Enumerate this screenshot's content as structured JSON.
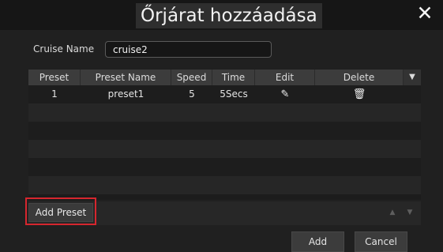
{
  "dialog": {
    "title": "Őrjárat hozzáadása",
    "close_icon": "close-icon"
  },
  "form": {
    "cruise_name_label": "Cruise Name",
    "cruise_name_value": "cruise2"
  },
  "table": {
    "columns": [
      "Preset",
      "Preset Name",
      "Speed",
      "Time",
      "Edit",
      "Delete"
    ],
    "dropdown_icon": "chevron-down-icon",
    "rows": [
      {
        "preset": "1",
        "preset_name": "preset1",
        "speed": "5",
        "time": "5Secs",
        "edit_icon": "pencil-icon",
        "delete_icon": "trash-icon"
      }
    ]
  },
  "actions": {
    "add_preset_label": "Add Preset",
    "move_up_icon": "arrow-up-icon",
    "move_down_icon": "arrow-down-icon",
    "add_label": "Add",
    "cancel_label": "Cancel"
  },
  "colors": {
    "highlight_border": "#d6262e",
    "background": "#202020"
  }
}
